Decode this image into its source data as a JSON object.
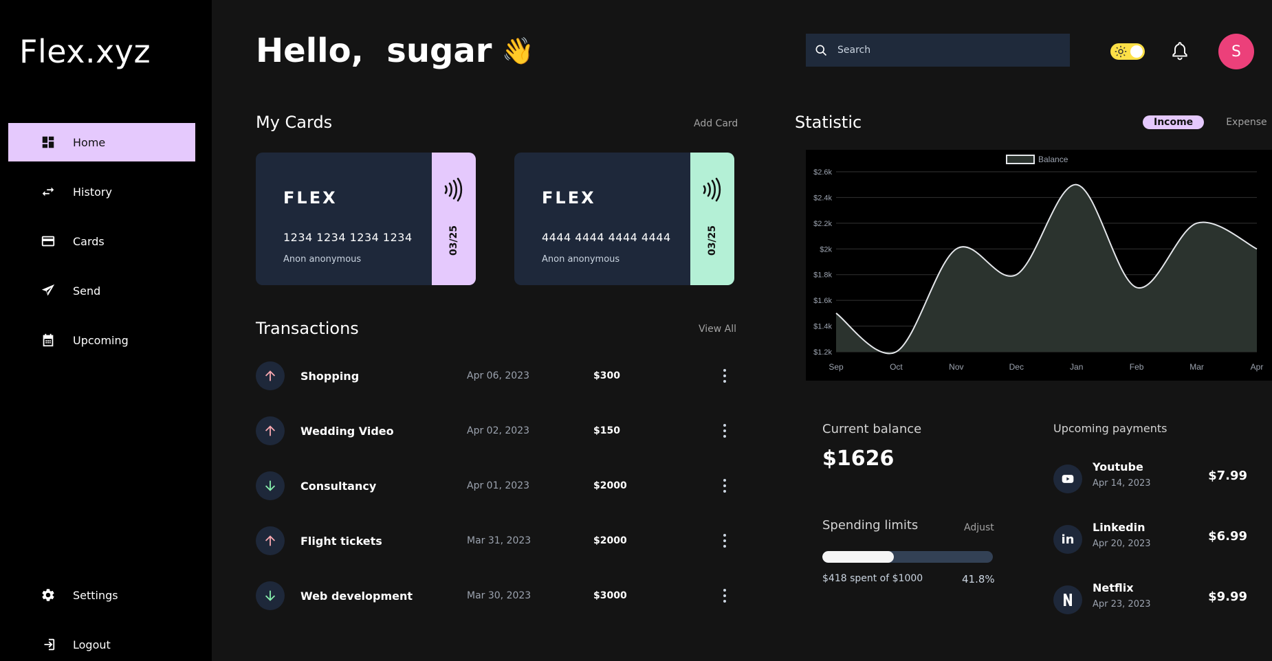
{
  "app": {
    "logo": "Flex.xyz"
  },
  "sidebar": {
    "items": [
      {
        "label": "Home",
        "icon": "dashboard-icon"
      },
      {
        "label": "History",
        "icon": "swap-arrows-icon"
      },
      {
        "label": "Cards",
        "icon": "credit-card-icon"
      },
      {
        "label": "Send",
        "icon": "paper-plane-icon"
      },
      {
        "label": "Upcoming",
        "icon": "calendar-icon"
      },
      {
        "label": "Settings",
        "icon": "gear-icon"
      },
      {
        "label": "Logout",
        "icon": "logout-icon"
      }
    ],
    "active": "Home"
  },
  "header": {
    "greeting": "Hello,  sugar",
    "wave": "👋",
    "search_placeholder": "Search",
    "avatar_initial": "S"
  },
  "cards_section": {
    "title": "My Cards",
    "add_label": "Add Card",
    "cards": [
      {
        "brand": "FLEX",
        "number": "1234 1234 1234 1234",
        "holder": "Anon anonymous",
        "expiry": "03/25",
        "accent": "#e5c9fd"
      },
      {
        "brand": "FLEX",
        "number": "4444 4444 4444 4444",
        "holder": "Anon anonymous",
        "expiry": "03/25",
        "accent": "#b4f0d6"
      }
    ]
  },
  "transactions": {
    "title": "Transactions",
    "view_all": "View All",
    "rows": [
      {
        "name": "Shopping",
        "date": "Apr 06, 2023",
        "amount": "$300",
        "direction": "up"
      },
      {
        "name": "Wedding Video",
        "date": "Apr 02, 2023",
        "amount": "$150",
        "direction": "up"
      },
      {
        "name": "Consultancy",
        "date": "Apr 01, 2023",
        "amount": "$2000",
        "direction": "down"
      },
      {
        "name": "Flight tickets",
        "date": "Mar 31, 2023",
        "amount": "$2000",
        "direction": "up"
      },
      {
        "name": "Web development",
        "date": "Mar 30, 2023",
        "amount": "$3000",
        "direction": "down"
      }
    ]
  },
  "statistic": {
    "title": "Statistic",
    "tabs": [
      "Income",
      "Expense"
    ],
    "active_tab": "Income"
  },
  "chart_data": {
    "type": "area",
    "title": "",
    "legend": [
      "Balance"
    ],
    "legend_position": "top-center",
    "categories": [
      "Sep",
      "Oct",
      "Nov",
      "Dec",
      "Jan",
      "Feb",
      "Mar",
      "Apr"
    ],
    "series": [
      {
        "name": "Balance",
        "values": [
          1500,
          1200,
          2000,
          1800,
          2500,
          1700,
          2200,
          2000
        ],
        "color": "#e5e7eb",
        "fill": "#2b332e"
      }
    ],
    "y_ticks": [
      "$1.2k",
      "$1.4k",
      "$1.6k",
      "$1.8k",
      "$2k",
      "$2.2k",
      "$2.4k",
      "$2.6k"
    ],
    "ylim": [
      1200,
      2600
    ],
    "grid": true
  },
  "balance": {
    "title": "Current balance",
    "amount": "$1626"
  },
  "spending": {
    "title": "Spending limits",
    "adjust": "Adjust",
    "spent_text": "$418 spent of $1000",
    "percent_text": "41.8%",
    "fraction": 0.418
  },
  "upcoming": {
    "title": "Upcoming payments",
    "items": [
      {
        "name": "Youtube",
        "date": "Apr 14, 2023",
        "amount": "$7.99",
        "icon": "youtube-icon"
      },
      {
        "name": "Linkedin",
        "date": "Apr 20, 2023",
        "amount": "$6.99",
        "icon": "linkedin-icon"
      },
      {
        "name": "Netflix",
        "date": "Apr 23, 2023",
        "amount": "$9.99",
        "icon": "netflix-icon"
      }
    ]
  }
}
